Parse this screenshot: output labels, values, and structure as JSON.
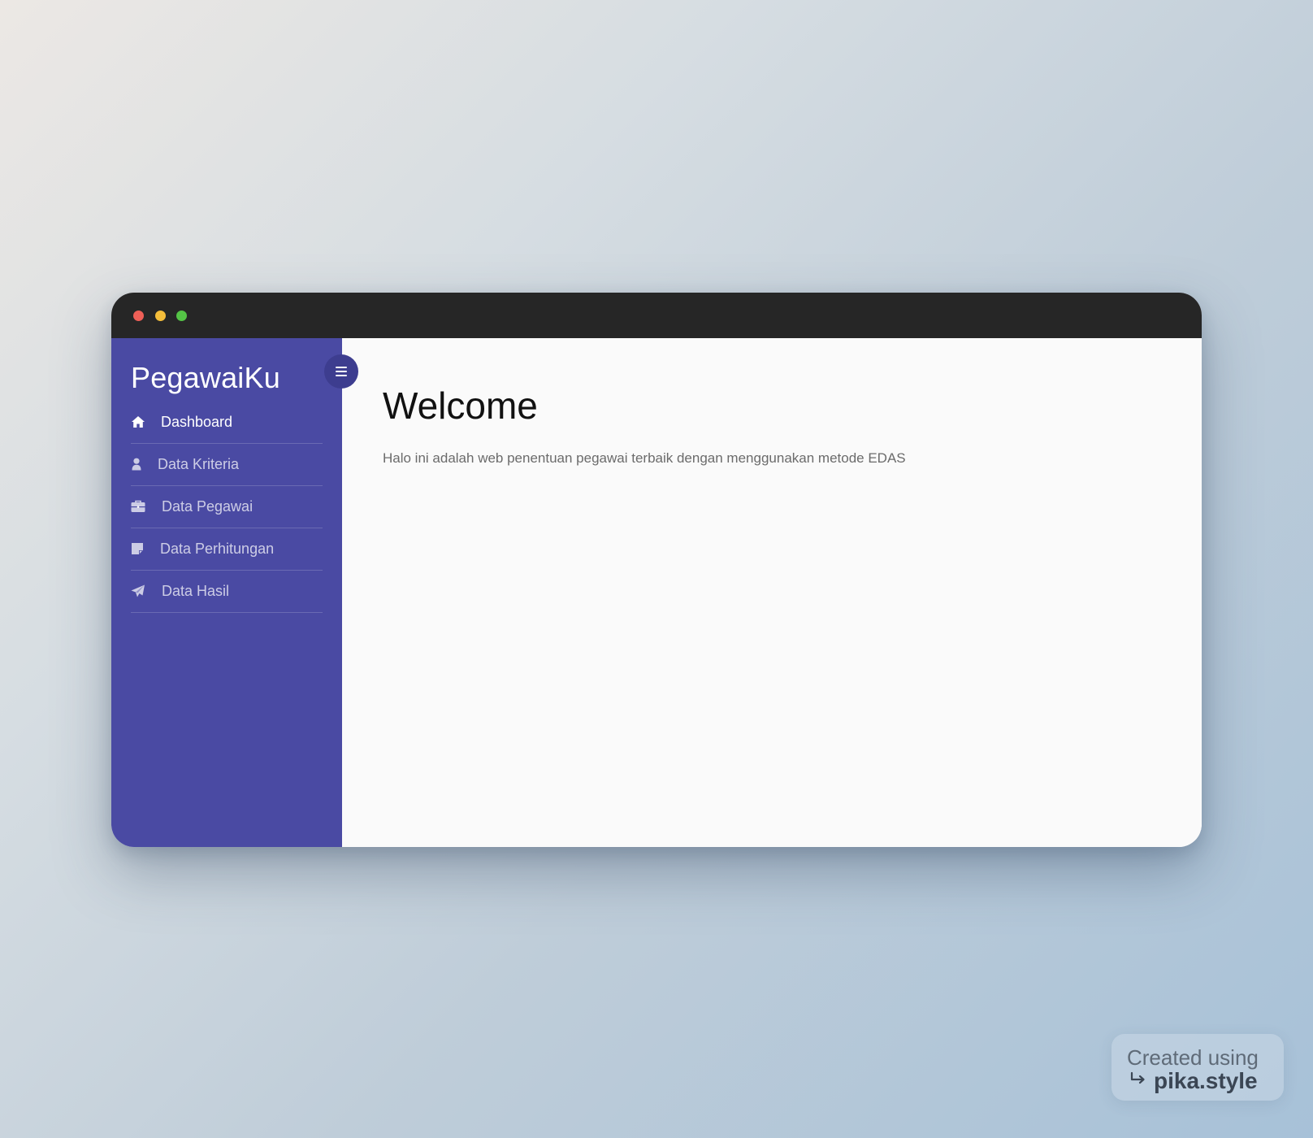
{
  "app": {
    "brand": "PegawaiKu"
  },
  "window_controls": [
    {
      "name": "close",
      "color": "#ee5f57"
    },
    {
      "name": "minimize",
      "color": "#f4bd3a"
    },
    {
      "name": "maximize",
      "color": "#54c346"
    }
  ],
  "sidebar": {
    "background": "#4a4aa3",
    "items": [
      {
        "label": "Dashboard",
        "icon": "home-icon",
        "active": true
      },
      {
        "label": "Data Kriteria",
        "icon": "user-icon",
        "active": false
      },
      {
        "label": "Data Pegawai",
        "icon": "briefcase-icon",
        "active": false
      },
      {
        "label": "Data Perhitungan",
        "icon": "note-icon",
        "active": false
      },
      {
        "label": "Data Hasil",
        "icon": "paper-plane-icon",
        "active": false
      }
    ]
  },
  "toggle": {
    "icon": "menu-icon"
  },
  "main": {
    "title": "Welcome",
    "description": "Halo ini adalah web penentuan pegawai terbaik dengan menggunakan metode EDAS"
  },
  "watermark": {
    "line1": "Created using",
    "line2": "pika.style",
    "icon": "return-arrow-icon"
  }
}
